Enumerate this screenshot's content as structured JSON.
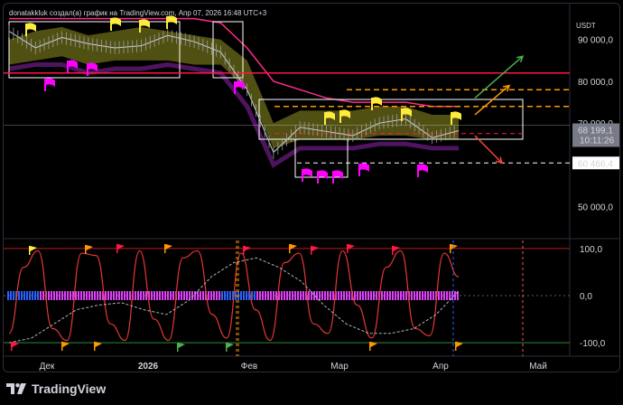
{
  "header": {
    "note": "donatakkluk создал(а) график на TradingView.com, Апр 07, 2026 16:48 UTC+3"
  },
  "footer": {
    "brand": "TradingView"
  },
  "price_panel": {
    "currency": "USDT",
    "current_price": "68 199,1",
    "countdown": "10:11:26",
    "level_label": "60 466,4"
  },
  "colors": {
    "background": "#000000",
    "price_axis_tag": "#787b86",
    "level_tag": "#ffffff",
    "red_level": "#ff1744",
    "orange_level": "#ff9800",
    "band_fill": "#6b6b1a",
    "flag_yellow": "#ffeb3b",
    "flag_magenta": "#ff00ff",
    "oscillator_line": "#e53935",
    "oscillator_dashed": "#b2b5be",
    "arrow_green": "#4caf50",
    "arrow_orange": "#ff9800",
    "arrow_red": "#f44336"
  },
  "chart_data": [
    {
      "type": "line",
      "name": "price",
      "x_tick_labels": [
        "Дек",
        "2026",
        "Фев",
        "Мар",
        "Апр",
        "Май"
      ],
      "y_tick_labels": [
        "90 000,0",
        "80 000,0",
        "70 000,0",
        "50 000,0"
      ],
      "ylim": [
        43000,
        96000
      ],
      "x": [
        "Nov 10",
        "Nov 20",
        "Dec 1",
        "Dec 10",
        "Dec 20",
        "Jan 1",
        "Jan 10",
        "Jan 20",
        "Jan 28",
        "Feb 1",
        "Feb 5",
        "Feb 10",
        "Feb 20",
        "Mar 1",
        "Mar 10",
        "Mar 20",
        "Apr 1",
        "Apr 7"
      ],
      "series": [
        {
          "values": [
            92000,
            88000,
            90500,
            89000,
            88000,
            88500,
            91000,
            89500,
            87000,
            78000,
            63000,
            69000,
            68000,
            67000,
            70000,
            71000,
            66500,
            68199
          ]
        }
      ],
      "horizontal_levels": [
        82000,
        78000,
        74000,
        67500,
        60466.4
      ],
      "projections": {
        "up": [
          76000,
          86000
        ],
        "mid": [
          72000,
          79000
        ],
        "down": [
          67000,
          60466
        ]
      }
    },
    {
      "type": "line",
      "name": "oscillator",
      "y_tick_labels": [
        "100,0",
        "0,0",
        "-100,0"
      ],
      "ylim": [
        -115,
        115
      ],
      "levels": [
        100,
        0,
        -100
      ],
      "series": [
        {
          "name": "",
          "values": [
            -80,
            60,
            95,
            -70,
            -95,
            90,
            85,
            -60,
            -95,
            95,
            -50,
            -95,
            80,
            95,
            -40,
            -90,
            90,
            -30,
            -95,
            70,
            90,
            -60,
            -80,
            95,
            -20,
            -90,
            60,
            95,
            -70,
            -85,
            90,
            40
          ]
        }
      ]
    }
  ]
}
